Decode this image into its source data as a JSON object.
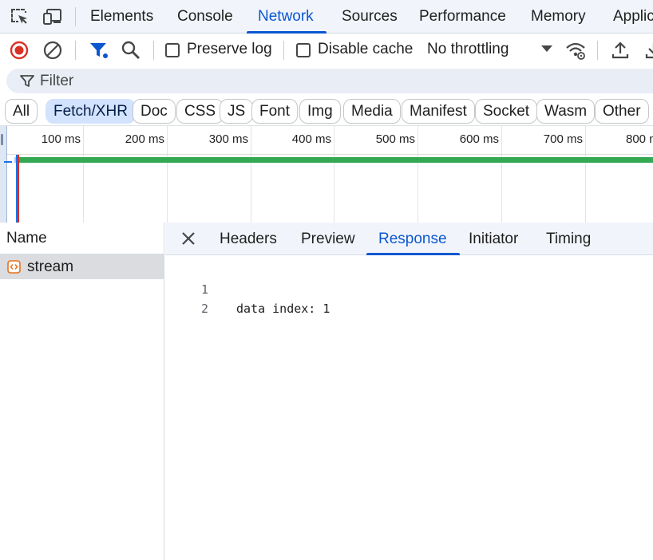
{
  "top_tabs": [
    {
      "label": "Elements"
    },
    {
      "label": "Console"
    },
    {
      "label": "Network",
      "active": true
    },
    {
      "label": "Sources"
    },
    {
      "label": "Performance"
    },
    {
      "label": "Memory"
    },
    {
      "label": "Applic"
    }
  ],
  "toolbar": {
    "preserve_log_label": "Preserve log",
    "preserve_log_checked": false,
    "disable_cache_label": "Disable cache",
    "disable_cache_checked": false,
    "throttling_value": "No throttling"
  },
  "filter": {
    "placeholder": "Filter"
  },
  "type_filters": [
    {
      "label": "All"
    },
    {
      "label": "Fetch/XHR",
      "active": true
    },
    {
      "label": "Doc"
    },
    {
      "label": "CSS"
    },
    {
      "label": "JS"
    },
    {
      "label": "Font"
    },
    {
      "label": "Img"
    },
    {
      "label": "Media"
    },
    {
      "label": "Manifest"
    },
    {
      "label": "Socket"
    },
    {
      "label": "Wasm"
    },
    {
      "label": "Other"
    }
  ],
  "timeline": {
    "ticks": [
      "100 ms",
      "200 ms",
      "300 ms",
      "400 ms",
      "500 ms",
      "600 ms",
      "700 ms",
      "800 m"
    ]
  },
  "requests": {
    "column_header": "Name",
    "rows": [
      {
        "name": "stream",
        "selected": true
      }
    ]
  },
  "details": {
    "tabs": [
      {
        "label": "Headers"
      },
      {
        "label": "Preview"
      },
      {
        "label": "Response",
        "active": true
      },
      {
        "label": "Initiator"
      },
      {
        "label": "Timing"
      }
    ],
    "response_lines": [
      {
        "number": "1",
        "text": "data index: 1"
      },
      {
        "number": "2",
        "text": ""
      }
    ]
  },
  "colors": {
    "accent": "#0b57d0",
    "record_red": "#d93025",
    "waterfall_green": "#34a853",
    "active_chip": "#d3e3fd",
    "panel_bg": "#f1f5fb"
  },
  "icons": {
    "inspect": "inspect-element-icon",
    "device": "device-toolbar-icon",
    "record": "record-stop-icon",
    "clear": "clear-icon",
    "filter": "filter-funnel-icon",
    "search": "search-icon",
    "network_conditions": "network-conditions-icon",
    "import": "import-har-icon",
    "export": "export-har-icon",
    "fetch": "fetch-request-icon",
    "close": "close-icon"
  }
}
